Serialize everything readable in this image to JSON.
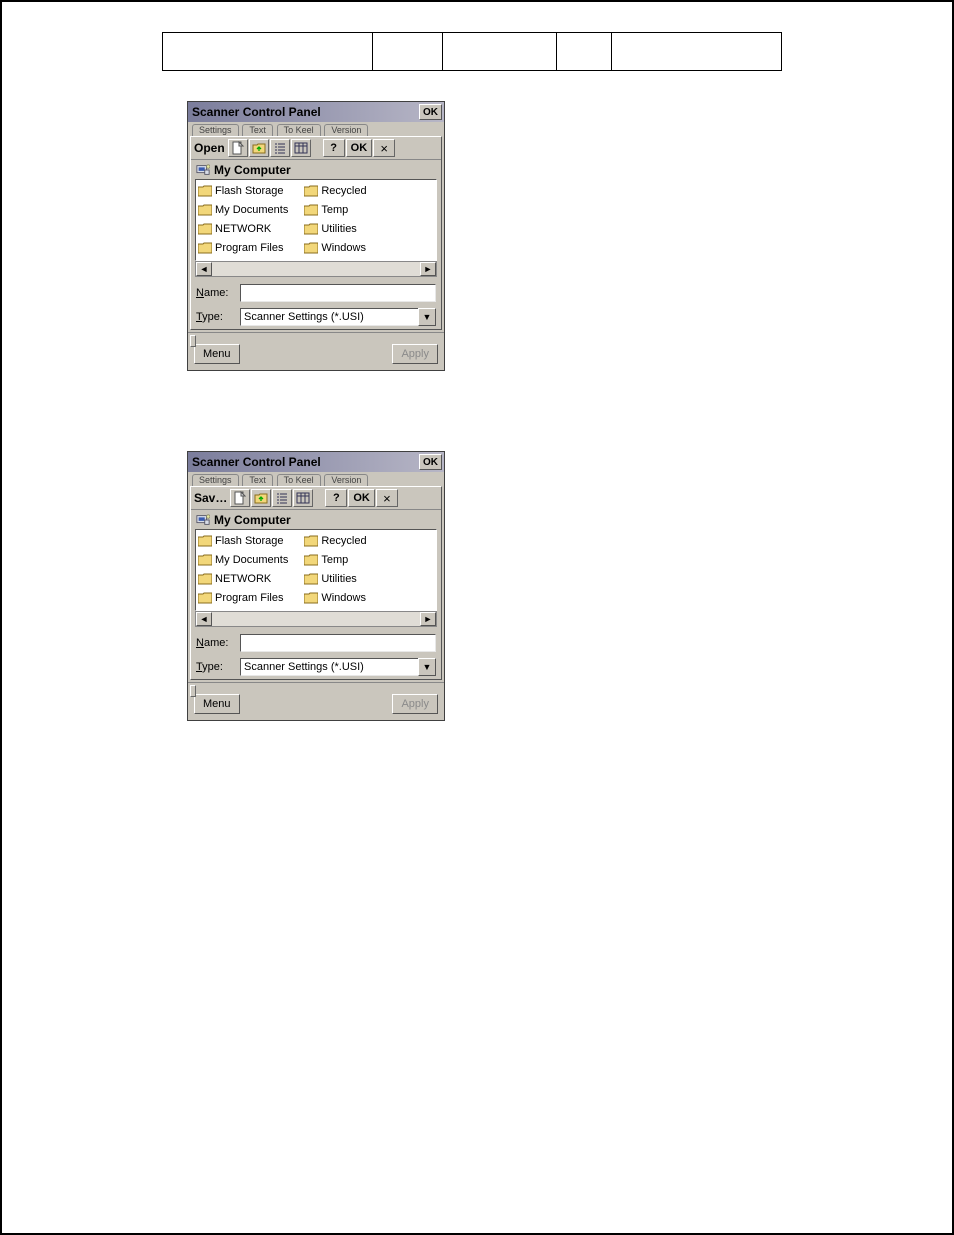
{
  "header_cells": [
    "",
    "",
    "",
    "",
    ""
  ],
  "parent_window": {
    "title": "Scanner Control Panel",
    "ok": "OK",
    "tabs": [
      "Settings",
      "Text",
      "To Keel",
      "Version"
    ]
  },
  "file_dialog": {
    "toolbar_ok": "OK",
    "toolbar_help": "?",
    "toolbar_close": "×",
    "location": "My Computer",
    "folders_col1": [
      "Flash Storage",
      "My Documents",
      "NETWORK",
      "Program Files"
    ],
    "folders_col2": [
      "Recycled",
      "Temp",
      "Utilities",
      "Windows"
    ],
    "name_label": "Name:",
    "name_ul": "N",
    "name_rest": "ame:",
    "type_label": "Type:",
    "type_ul": "T",
    "type_rest": "ype:",
    "name_value": "",
    "type_value": "Scanner Settings (*.USI)",
    "scroll_left": "◄",
    "scroll_right": "►",
    "dropdown_arrow": "▼"
  },
  "dialog_open_mode": "Open",
  "dialog_save_mode": "Sav…",
  "footer": {
    "menu": "Menu",
    "apply": "Apply"
  },
  "icons": {
    "doc_new": "new-doc-icon",
    "folder_up": "folder-up-icon",
    "list_view": "list-view-icon",
    "details_view": "details-view-icon",
    "computer": "computer-icon",
    "folder": "folder-icon"
  }
}
